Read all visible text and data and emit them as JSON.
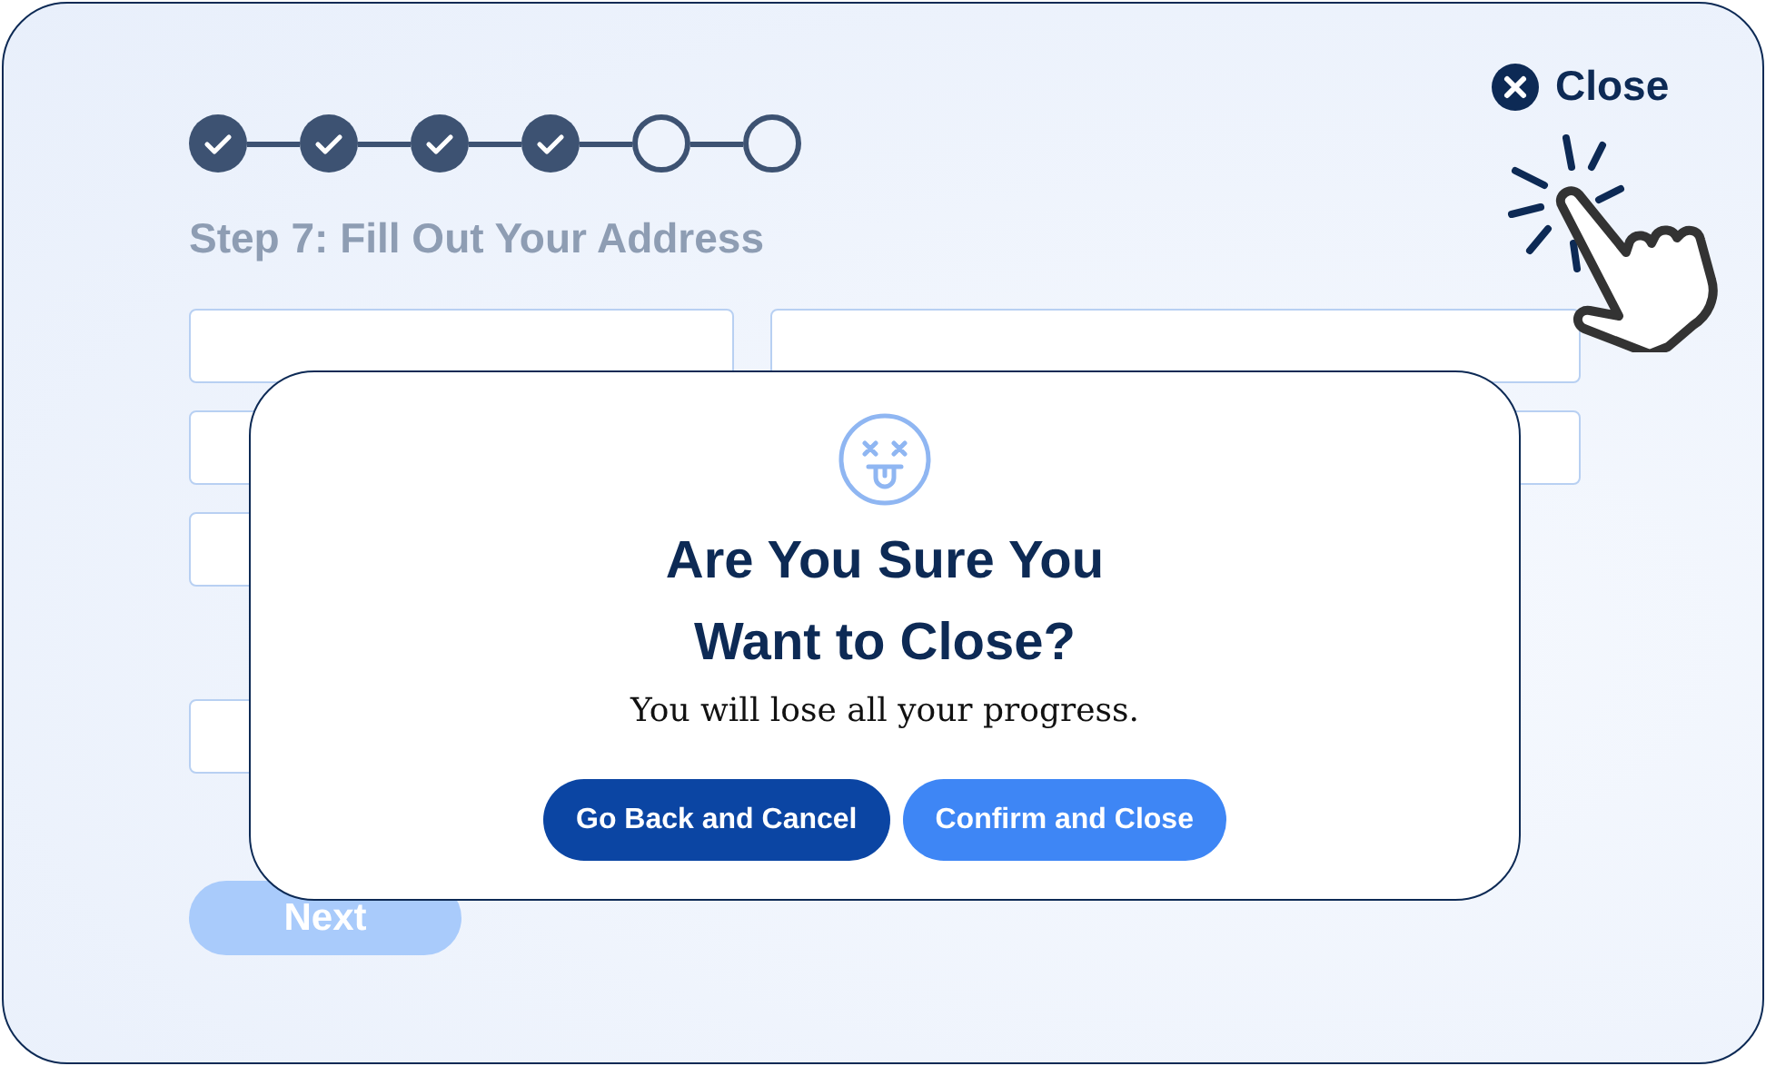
{
  "steps": [
    {
      "completed": true
    },
    {
      "completed": true
    },
    {
      "completed": true
    },
    {
      "completed": true
    },
    {
      "completed": false
    },
    {
      "completed": false
    }
  ],
  "step_title": "Step 7: Fill Out Your Address",
  "close_link": {
    "label": "Close"
  },
  "next_button": {
    "label": "Next",
    "disabled": true
  },
  "dialog": {
    "title": "Are You Sure You Want to Close?",
    "message": "You will lose all your progress.",
    "buttons": [
      {
        "label": "Go Back and Cancel",
        "kind": "primary"
      },
      {
        "label": "Confirm and Close",
        "kind": "secondary"
      }
    ]
  }
}
